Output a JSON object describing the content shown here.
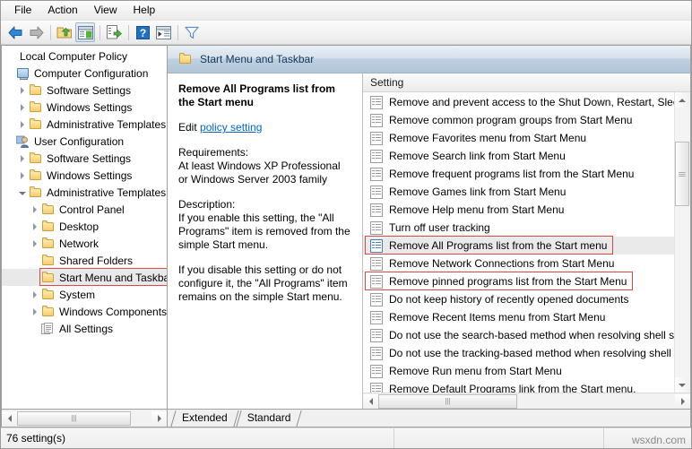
{
  "window": {
    "menu": [
      "File",
      "Action",
      "View",
      "Help"
    ],
    "toolbar_icons": [
      "back-arrow-icon",
      "forward-arrow-icon",
      "up-folder-icon",
      "show-hide-console-tree-icon",
      "export-list-icon",
      "help-icon",
      "show-action-pane-icon",
      "filter-icon"
    ]
  },
  "tree": {
    "root": "Local Computer Policy",
    "items": [
      {
        "label": "Local Computer Policy",
        "indent": 0,
        "twisty": "none",
        "icon": "none"
      },
      {
        "label": "Computer Configuration",
        "indent": 0,
        "twisty": "none",
        "icon": "computer-icon"
      },
      {
        "label": "Software Settings",
        "indent": 1,
        "twisty": "collapsed",
        "icon": "folder-icon"
      },
      {
        "label": "Windows Settings",
        "indent": 1,
        "twisty": "collapsed",
        "icon": "folder-icon"
      },
      {
        "label": "Administrative Templates",
        "indent": 1,
        "twisty": "collapsed",
        "icon": "folder-icon"
      },
      {
        "label": "User Configuration",
        "indent": 0,
        "twisty": "none",
        "icon": "user-icon"
      },
      {
        "label": "Software Settings",
        "indent": 1,
        "twisty": "collapsed",
        "icon": "folder-icon"
      },
      {
        "label": "Windows Settings",
        "indent": 1,
        "twisty": "collapsed",
        "icon": "folder-icon"
      },
      {
        "label": "Administrative Templates",
        "indent": 1,
        "twisty": "expanded",
        "icon": "folder-icon"
      },
      {
        "label": "Control Panel",
        "indent": 2,
        "twisty": "collapsed",
        "icon": "folder-icon"
      },
      {
        "label": "Desktop",
        "indent": 2,
        "twisty": "collapsed",
        "icon": "folder-icon"
      },
      {
        "label": "Network",
        "indent": 2,
        "twisty": "collapsed",
        "icon": "folder-icon"
      },
      {
        "label": "Shared Folders",
        "indent": 2,
        "twisty": "none",
        "icon": "folder-icon"
      },
      {
        "label": "Start Menu and Taskbar",
        "indent": 2,
        "twisty": "none",
        "icon": "folder-icon",
        "selected": true,
        "highlight": true
      },
      {
        "label": "System",
        "indent": 2,
        "twisty": "collapsed",
        "icon": "folder-icon"
      },
      {
        "label": "Windows Components",
        "indent": 2,
        "twisty": "collapsed",
        "icon": "folder-icon"
      },
      {
        "label": "All Settings",
        "indent": 2,
        "twisty": "none",
        "icon": "all-settings-icon"
      }
    ]
  },
  "right_pane": {
    "header_title": "Start Menu and Taskbar",
    "header_icon": "folder-icon",
    "description": {
      "title": "Remove All Programs list from the Start menu",
      "edit_prefix": "Edit ",
      "edit_link": "policy setting",
      "requirements_label": "Requirements:",
      "requirements_text": "At least Windows XP Professional or Windows Server 2003 family",
      "description_label": "Description:",
      "description_p1": "If you enable this setting, the \"All Programs\" item is removed from the simple Start menu.",
      "description_p2": "If you disable this setting or do not configure it, the \"All Programs\" item remains on the simple Start menu."
    },
    "list": {
      "column_header": "Setting",
      "rows": [
        {
          "label": "Remove and prevent access to the Shut Down, Restart, Sleep..",
          "highlight": false,
          "selected": false
        },
        {
          "label": "Remove common program groups from Start Menu",
          "highlight": false,
          "selected": false
        },
        {
          "label": "Remove Favorites menu from Start Menu",
          "highlight": false,
          "selected": false
        },
        {
          "label": "Remove Search link from Start Menu",
          "highlight": false,
          "selected": false
        },
        {
          "label": "Remove frequent programs list from the Start Menu",
          "highlight": false,
          "selected": false
        },
        {
          "label": "Remove Games link from Start Menu",
          "highlight": false,
          "selected": false
        },
        {
          "label": "Remove Help menu from Start Menu",
          "highlight": false,
          "selected": false
        },
        {
          "label": "Turn off user tracking",
          "highlight": false,
          "selected": false
        },
        {
          "label": "Remove All Programs list from the Start menu",
          "highlight": true,
          "selected": true
        },
        {
          "label": "Remove Network Connections from Start Menu",
          "highlight": false,
          "selected": false
        },
        {
          "label": "Remove pinned programs list from the Start Menu",
          "highlight": true,
          "selected": false
        },
        {
          "label": "Do not keep history of recently opened documents",
          "highlight": false,
          "selected": false
        },
        {
          "label": "Remove Recent Items menu from Start Menu",
          "highlight": false,
          "selected": false
        },
        {
          "label": "Do not use the search-based method when resolving shell s...",
          "highlight": false,
          "selected": false
        },
        {
          "label": "Do not use the tracking-based method when resolving shell ..",
          "highlight": false,
          "selected": false
        },
        {
          "label": "Remove Run menu from Start Menu",
          "highlight": false,
          "selected": false
        },
        {
          "label": "Remove Default Programs link from the Start menu.",
          "highlight": false,
          "selected": false
        }
      ]
    }
  },
  "tabs": [
    {
      "label": "Extended",
      "active": false
    },
    {
      "label": "Standard",
      "active": true
    }
  ],
  "status": {
    "text": "76 setting(s)",
    "watermark": "wsxdn.com"
  },
  "colors": {
    "highlight_red": "#d94a45",
    "link_blue": "#0066cc",
    "header_blue": "#b2c6d9",
    "selection_gray": "#eaeaea"
  }
}
